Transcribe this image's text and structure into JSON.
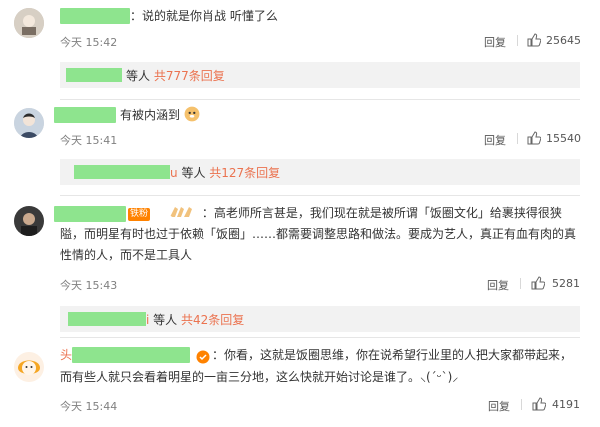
{
  "comments": [
    {
      "text": "：说的就是你肖战 听懂了么",
      "time": "今天 15:42",
      "reply": "回复",
      "likes": "25645",
      "sub": {
        "who": "等人",
        "count": "共777条回复"
      }
    },
    {
      "text": "有被内涵到",
      "time": "今天 15:41",
      "reply": "回复",
      "likes": "15540",
      "sub": {
        "suffix": "u",
        "who": "等人",
        "count": "共127条回复"
      }
    },
    {
      "badge": "铁粉",
      "text_line1": "：高老师所言甚是，我们现在就是被所谓「饭圈文化」给裹挟得很狭",
      "text_line2": "隘，而明星有时也过于依赖「饭圈」……都需要调整思路和做法。要成为艺人，真正有血有肉的真",
      "text_line3": "性情的人，而不是工具人",
      "time": "今天 15:43",
      "reply": "回复",
      "likes": "5281",
      "sub": {
        "suffix": "i",
        "who": "等人",
        "count": "共42条回复"
      }
    },
    {
      "prefix": "头",
      "text_line1": "：你看，这就是饭圈思维，你在说希望行业里的人把大家都带起来，",
      "text_line2": "而有些人就只会看着明星的一亩三分地，这么快就开始讨论是谁了。⸜(ˊᵕˋ)⸝",
      "time": "今天 15:44",
      "reply": "回复",
      "likes": "4191"
    }
  ],
  "colors": {
    "mask": "#8ee48e",
    "accent": "#eb7350",
    "badge": "#ff8200"
  }
}
